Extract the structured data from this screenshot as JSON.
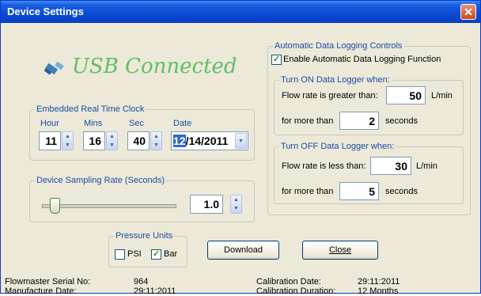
{
  "window": {
    "title": "Device Settings",
    "close_glyph": "✕"
  },
  "usb_status": "USB Connected",
  "rtc": {
    "legend": "Embedded Real Time Clock",
    "hour_label": "Hour",
    "mins_label": "Mins",
    "sec_label": "Sec",
    "date_label": "Date",
    "hour": "11",
    "mins": "16",
    "sec": "40",
    "date_day": "12",
    "date_rest": "/14/2011"
  },
  "sampling": {
    "legend": "Device Sampling Rate (Seconds)",
    "value": "1.0",
    "level": 0.1
  },
  "logging": {
    "legend": "Automatic Data Logging Controls",
    "enable_label": "Enable Automatic Data Logging Function",
    "enable_checked": true,
    "on": {
      "legend": "Turn ON Data Logger when:",
      "flow_label": "Flow rate is greater than:",
      "flow_value": "50",
      "flow_unit": "L/min",
      "time_label": "for more than",
      "time_value": "2",
      "time_unit": "seconds"
    },
    "off": {
      "legend": "Turn OFF Data Logger when:",
      "flow_label": "Flow rate is less than:",
      "flow_value": "30",
      "flow_unit": "L/min",
      "time_label": "for more than",
      "time_value": "5",
      "time_unit": "seconds"
    }
  },
  "pressure": {
    "legend": "Pressure Units",
    "psi_label": "PSI",
    "psi_checked": false,
    "bar_label": "Bar",
    "bar_checked": true
  },
  "buttons": {
    "download": "Download",
    "close": "Close"
  },
  "info": {
    "serial_label": "Flowmaster Serial No:",
    "serial_value": "964",
    "manufacture_label": "Manufacture Date:",
    "manufacture_value": "29:11:2011",
    "calibration_label": "Calibration Date:",
    "calibration_value": "29:11:2011",
    "duration_label": "Calibration Duration:",
    "duration_value": "12 Months"
  },
  "icons": {
    "usb": "usb-plug-icon",
    "spin_up": "▲",
    "spin_down": "▼",
    "dropdown": "chevron-down-icon"
  }
}
